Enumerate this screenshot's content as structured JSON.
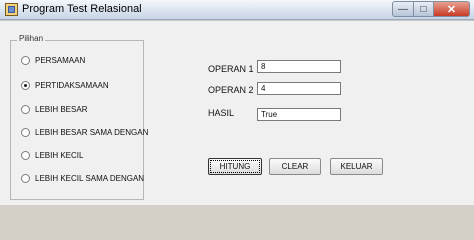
{
  "window": {
    "title": "Program Test Relasional",
    "buttons": {
      "minimize": "—",
      "maximize": "□",
      "close": "✕"
    }
  },
  "group": {
    "label": "Pilihan",
    "options": [
      {
        "label": "PERSAMAAN",
        "checked": false
      },
      {
        "label": "PERTIDAKSAMAAN",
        "checked": true
      },
      {
        "label": "LEBIH BESAR",
        "checked": false
      },
      {
        "label": "LEBIH BESAR SAMA DENGAN",
        "checked": false
      },
      {
        "label": "LEBIH KECIL",
        "checked": false
      },
      {
        "label": "LEBIH KECIL SAMA DENGAN",
        "checked": false
      }
    ]
  },
  "fields": {
    "operan1": {
      "label": "OPERAN 1",
      "value": "8"
    },
    "operan2": {
      "label": "OPERAN 2",
      "value": "4"
    },
    "hasil": {
      "label": "HASIL",
      "value": "True"
    }
  },
  "buttons": {
    "hitung": "HITUNG",
    "clear": "CLEAR",
    "keluar": "KELUAR"
  }
}
